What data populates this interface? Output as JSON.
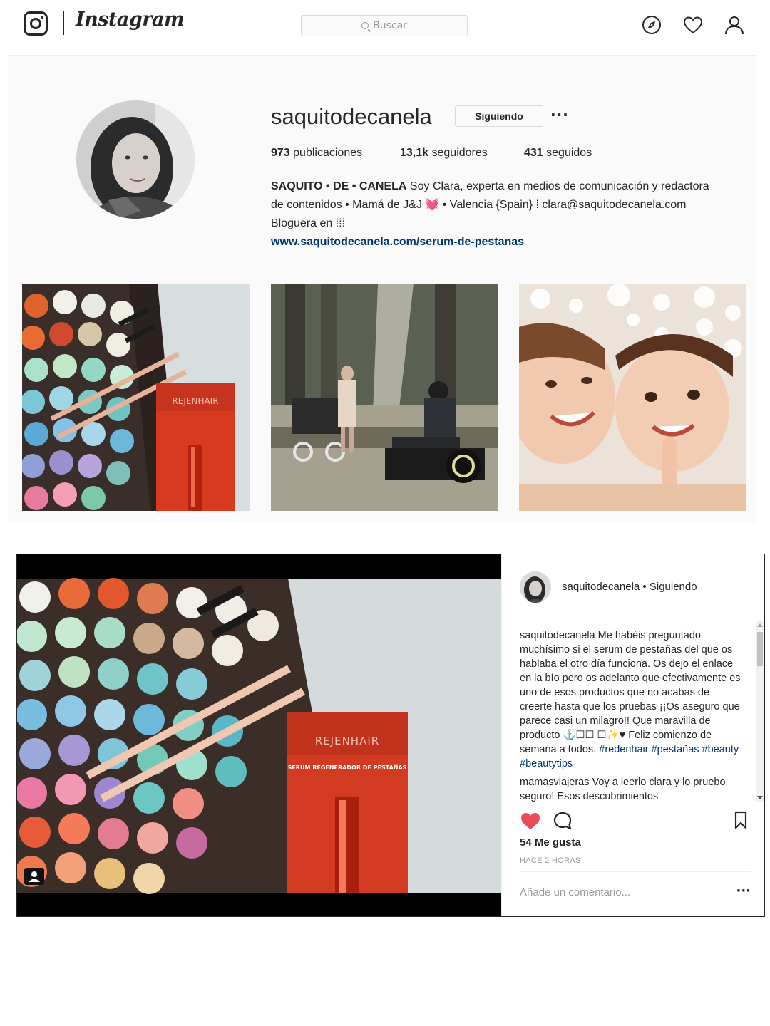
{
  "header": {
    "wordmark": "Instagram",
    "search_placeholder": "Buscar",
    "icons": [
      "instagram-glyph-icon",
      "explore-compass-icon",
      "activity-heart-icon",
      "profile-person-icon"
    ]
  },
  "profile": {
    "username": "saquitodecanela",
    "follow_label": "Siguiendo",
    "more_label": "···",
    "stats": [
      {
        "num": "973",
        "label": "publicaciones"
      },
      {
        "num": "13,1k",
        "label": "seguidores"
      },
      {
        "num": "431",
        "label": "seguidos"
      }
    ],
    "bio_name": "SAQUITO • DE • CANELA",
    "bio_line1": " Soy Clara, experta en medios de comunicación y redactora",
    "bio_line2": "de contenidos • Mamá de J&J 💓 • Valencia {Spain} ⁞ clara@saquitodecanela.com",
    "bio_line3": "Bloguera en ⁞⁞⁞",
    "bio_link": "www.saquitodecanela.com/serum-de-pestanas"
  },
  "post": {
    "username": "saquitodecanela",
    "separator": " • ",
    "follow_state": "Siguiendo",
    "caption_user": "saquitodecanela",
    "caption_text": " Me habéis preguntado muchísimo si el serum de pestañas del que os hablaba el otro día funciona. Os dejo el enlace en la bío pero os adelanto que efectivamente es uno de esos productos que no acabas de creerte hasta que los pruebas ¡¡Os aseguro que parece casi un milagro!! Que maravilla de producto ⚓☐☐ ☐✨♥ Feliz comienzo de semana a todos.",
    "caption_tags": "#redenhair #pestañas #beauty #beautytips",
    "comment_user": "mamasviajeras",
    "comment_text": " Voy a leerlo clara y lo pruebo seguro! Esos descubrimientos",
    "likes": "54 Me gusta",
    "time": "HACE 2 HORAS",
    "comment_placeholder": "Añade un comentario...",
    "comment_more": "···",
    "product_brand": "REJENHAIR",
    "product_desc": "SERUM REGENERADOR DE PESTAÑAS"
  },
  "colors": {
    "accent_like": "#ed4956",
    "link": "#003569",
    "muted": "#999999",
    "border": "#dbdbdb",
    "panel_bg": "#fafafa"
  }
}
